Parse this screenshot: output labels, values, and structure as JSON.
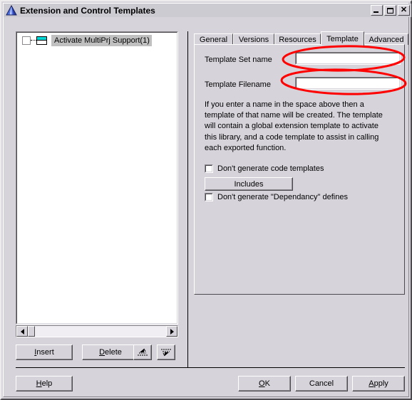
{
  "window": {
    "title": "Extension and Control Templates",
    "icon": "pyramid-icon",
    "controls": {
      "minimize": "_",
      "maximize": "□",
      "close": "✕"
    }
  },
  "tree": {
    "items": [
      {
        "label": "Activate MultiPrj Support(1)",
        "checked": false,
        "selected": true,
        "icon": "window-node-icon"
      }
    ],
    "scrollbar": {
      "left_arrow": "◀",
      "right_arrow": "▶"
    }
  },
  "list_buttons": {
    "insert": "Insert",
    "insert_accel": "I",
    "delete": "Delete",
    "delete_accel": "D",
    "move_icon_1": "move-up-icon",
    "move_icon_2": "move-down-icon"
  },
  "tabs": [
    {
      "label": "General",
      "active": false
    },
    {
      "label": "Versions",
      "active": false
    },
    {
      "label": "Resources",
      "active": false
    },
    {
      "label": "Template",
      "active": true
    },
    {
      "label": "Advanced",
      "active": false
    }
  ],
  "template_panel": {
    "set_name": {
      "label": "Template Set name",
      "value": "",
      "placeholder": ""
    },
    "filename": {
      "label": "Template Filename",
      "value": "",
      "placeholder": ""
    },
    "description": "If you enter a name in the space above then a template of that name will be created. The template will contain a global extension template to activate this library, and a code template to assist in calling each exported function.",
    "checkbox_code_templates": {
      "label": "Don't generate code templates",
      "checked": false
    },
    "includes_button": "Includes",
    "checkbox_dependancy": {
      "label": "Don't generate \"Dependancy\" defines",
      "checked": false
    }
  },
  "footer": {
    "help": "Help",
    "help_accel": "H",
    "ok": "OK",
    "ok_accel": "O",
    "cancel": "Cancel",
    "apply": "Apply",
    "apply_accel": "A"
  },
  "annotations": {
    "color": "#ff0000",
    "shapes": [
      {
        "name": "ellipse-template-set-name"
      },
      {
        "name": "ellipse-template-filename"
      }
    ]
  },
  "colors": {
    "window_face": "#d6d3da",
    "titlebar": "#cdcbd2",
    "selection": "#c0c0c0",
    "field_bg": "#ffffff",
    "annotation_red": "#ff0000",
    "node_icon_cyan": "#00d7d7"
  }
}
